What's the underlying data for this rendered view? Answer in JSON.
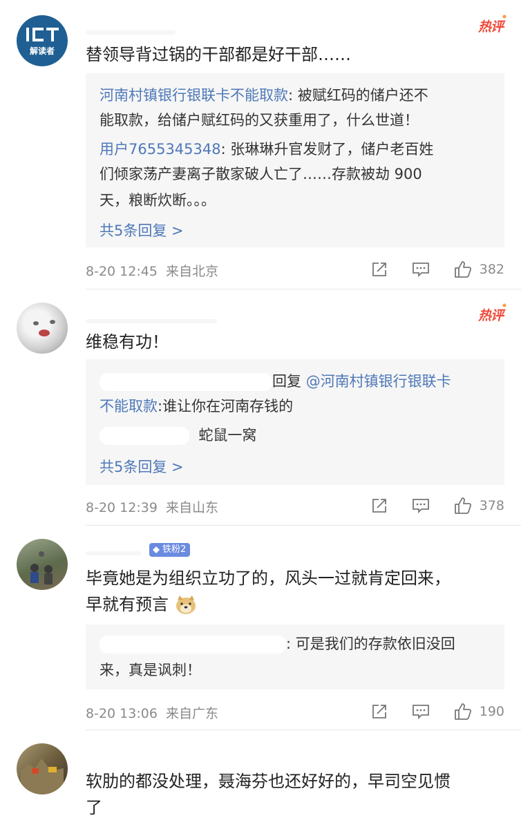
{
  "comments": [
    {
      "avatar_text": "解读者",
      "hot_label": "热评",
      "text": "替领导背过锅的干部都是好干部……",
      "replies": [
        {
          "author": "河南村镇银行银联卡不能取款",
          "sep": ": ",
          "body": "被赋红码的储户还不",
          "cont": "能取款，给储户赋红码的又获重用了，什么世道！"
        },
        {
          "author": "用户7655345348",
          "sep": ": ",
          "body": "张琳琳升官发财了，储户老百姓",
          "cont": "们倾家荡产妻离子散家破人亡了……存款被劫 900",
          "cont2": "天，粮断炊断。。。"
        }
      ],
      "more": "共5条回复 >",
      "time": "8-20 12:45",
      "source": "来自北京",
      "likes": "382"
    },
    {
      "hot_label": "热评",
      "text": "维稳有功！",
      "reply_prefix": "回复",
      "mention": "@河南村镇银行银联卡",
      "mention_cont": "不能取款",
      "reply_body": ":谁让你在河南存钱的",
      "reply2_body": "蛇鼠一窝",
      "more": "共5条回复 >",
      "time": "8-20 12:39",
      "source": "来自山东",
      "likes": "378"
    },
    {
      "fan_badge": "铁粉2",
      "text_line1": "毕竟她是为组织立功了的，风头一过就肯定回来，",
      "text_line2": "早就有预言",
      "reply_body": ": 可是我们的存款依旧没回",
      "reply_cont": "来，真是讽刺！",
      "time": "8-20 13:06",
      "source": "来自广东",
      "likes": "190"
    },
    {
      "text_line1": "软肋的都没处理，聂海芬也还好好的，早司空见惯",
      "text_line2": "了"
    }
  ],
  "colors": {
    "link": "#4e78b8",
    "hot": "#f04a3a",
    "meta": "#8a8a8a",
    "reply_bg": "#f6f6f6"
  }
}
